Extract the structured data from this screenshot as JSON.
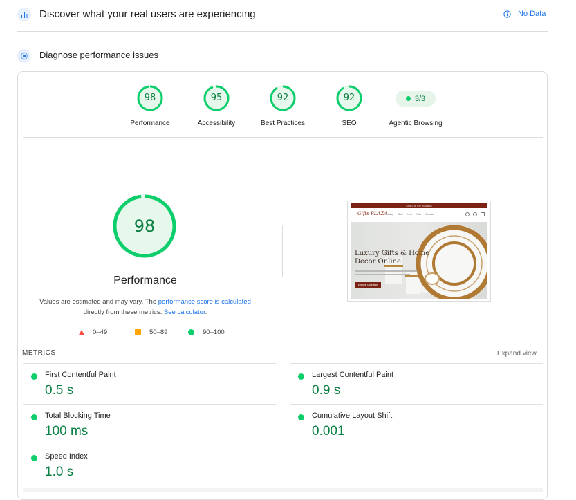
{
  "field_section": {
    "title": "Discover what your real users are experiencing",
    "status_label": "No Data",
    "status_icon": "info-icon"
  },
  "lab_section": {
    "title": "Diagnose performance issues"
  },
  "categories": [
    {
      "score": "98",
      "label": "Performance"
    },
    {
      "score": "95",
      "label": "Accessibility"
    },
    {
      "score": "92",
      "label": "Best Practices"
    },
    {
      "score": "92",
      "label": "SEO"
    }
  ],
  "agentic": {
    "value": "3/3",
    "label": "Agentic Browsing"
  },
  "main_gauge": {
    "score": "98",
    "label": "Performance",
    "fraction": 0.98
  },
  "note": {
    "prefix": "Values are estimated and may vary. The ",
    "link1": "performance score is calculated",
    "mid": " directly from these metrics. ",
    "link2": "See calculator",
    "suffix": "."
  },
  "legend": [
    {
      "range": "0–49",
      "color": "#ff4e42",
      "shape": "triangle"
    },
    {
      "range": "50–89",
      "color": "#ffa400",
      "shape": "square"
    },
    {
      "range": "90–100",
      "color": "#0cce6b",
      "shape": "circle"
    }
  ],
  "metrics_header": {
    "title": "METRICS",
    "expand": "Expand view"
  },
  "metrics": [
    {
      "name": "First Contentful Paint",
      "value": "0.5 s"
    },
    {
      "name": "Largest Contentful Paint",
      "value": "0.9 s"
    },
    {
      "name": "Total Blocking Time",
      "value": "100 ms"
    },
    {
      "name": "Cumulative Layout Shift",
      "value": "0.001"
    },
    {
      "name": "Speed Index",
      "value": "1.0 s"
    }
  ],
  "screenshot": {
    "banner": "Shop for the holidays",
    "logo": "Gifts PLAZA",
    "nav": [
      "Catalog",
      "Shop",
      "New",
      "Sale",
      "Contact"
    ],
    "headline1": "Luxury Gifts & Home",
    "headline2": "Decor Online",
    "cta": "Explore Collection"
  },
  "colors": {
    "good": "#0cce6b",
    "good_text": "#0b8043",
    "link": "#1a73e8"
  }
}
